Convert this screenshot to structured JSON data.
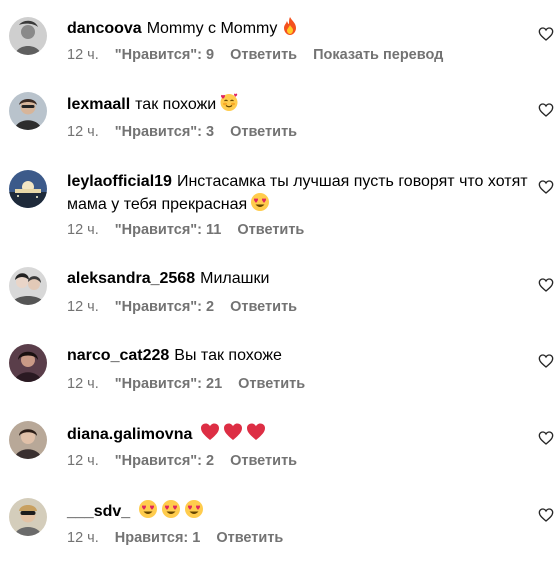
{
  "comments": [
    {
      "username": "dancoova",
      "text": "Mommy с Mommy",
      "time": "12 ч.",
      "likes": "\"Нравится\": 9",
      "reply": "Ответить",
      "translate": "Показать перевод",
      "emoji": [
        "fire-emoji"
      ]
    },
    {
      "username": "lexmaall",
      "text": "так похожи",
      "time": "12 ч.",
      "likes": "\"Нравится\": 3",
      "reply": "Ответить",
      "emoji": [
        "smiling-face-with-hearts-emoji"
      ]
    },
    {
      "username": "leylaofficial19",
      "text": "Инстасамка ты лучшая пусть говорят что хотят мама у тебя прекрасная",
      "time": "12 ч.",
      "likes": "\"Нравится\": 11",
      "reply": "Ответить",
      "emoji": [
        "heart-eyes-emoji"
      ]
    },
    {
      "username": "aleksandra_2568",
      "text": "Милашки",
      "time": "12 ч.",
      "likes": "\"Нравится\": 2",
      "reply": "Ответить",
      "emoji": []
    },
    {
      "username": "narco_cat228",
      "text": "Вы так похоже",
      "time": "12 ч.",
      "likes": "\"Нравится\": 21",
      "reply": "Ответить",
      "emoji": []
    },
    {
      "username": "diana.galimovna",
      "text": "",
      "time": "12 ч.",
      "likes": "\"Нравится\": 2",
      "reply": "Ответить",
      "emoji": [
        "red-heart-emoji",
        "red-heart-emoji",
        "red-heart-emoji"
      ]
    },
    {
      "username": "___sdv_",
      "text": "",
      "time": "12 ч.",
      "likes": "Нравится: 1",
      "reply": "Ответить",
      "emoji": [
        "heart-eyes-emoji",
        "heart-eyes-emoji",
        "heart-eyes-emoji"
      ]
    }
  ],
  "icons": {
    "like": "heart-outline-icon"
  },
  "colors": {
    "text": "#000000",
    "meta": "#737373"
  }
}
